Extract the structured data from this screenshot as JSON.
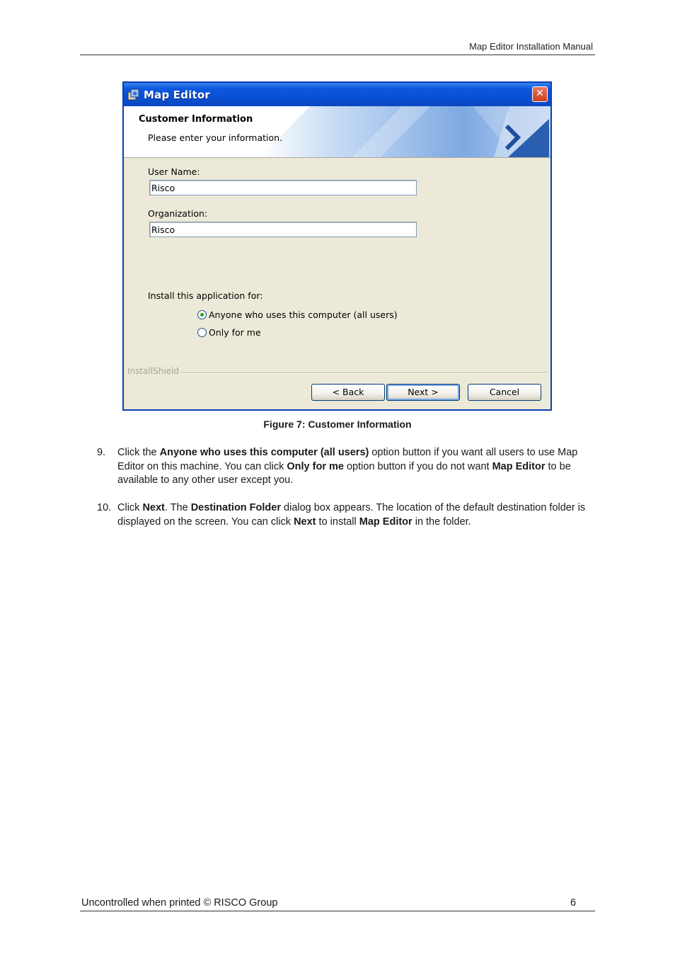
{
  "header": {
    "title": "Map Editor Installation Manual"
  },
  "dialog": {
    "title": "Map Editor",
    "close_glyph": "✕",
    "banner_title": "Customer Information",
    "banner_subtitle": "Please enter your information.",
    "user_name_label": "User Name:",
    "user_name_value": "Risco",
    "organization_label": "Organization:",
    "organization_value": "Risco",
    "install_for_label": "Install this application for:",
    "options": [
      {
        "label": "Anyone who uses this computer (all users)",
        "selected": true
      },
      {
        "label": "Only for me",
        "selected": false
      }
    ],
    "brand": "InstallShield",
    "buttons": {
      "back": "< Back",
      "next": "Next >",
      "cancel": "Cancel"
    }
  },
  "caption": "Figure 7: Customer Information",
  "steps": [
    {
      "number": "9.",
      "parts": [
        {
          "t": "Click the ",
          "b": false
        },
        {
          "t": "Anyone who uses this computer (all users)",
          "b": true
        },
        {
          "t": " option button if you want all users to use Map Editor on this machine. You can click ",
          "b": false
        },
        {
          "t": "Only for me",
          "b": true
        },
        {
          "t": " option button if you do not want ",
          "b": false
        },
        {
          "t": "Map Editor",
          "b": true
        },
        {
          "t": " to be available to any other user except you.",
          "b": false
        }
      ]
    },
    {
      "number": "10.",
      "parts": [
        {
          "t": "Click ",
          "b": false
        },
        {
          "t": "Next",
          "b": true
        },
        {
          "t": ". The ",
          "b": false
        },
        {
          "t": "Destination Folder",
          "b": true
        },
        {
          "t": " dialog box appears. The location of the default destination folder is displayed on the screen. You can click ",
          "b": false
        },
        {
          "t": "Next",
          "b": true
        },
        {
          "t": " to install ",
          "b": false
        },
        {
          "t": "Map Editor",
          "b": true
        },
        {
          "t": " in the folder.",
          "b": false
        }
      ]
    }
  ],
  "footer": {
    "left": "Uncontrolled when printed © RISCO Group",
    "page": "6"
  }
}
